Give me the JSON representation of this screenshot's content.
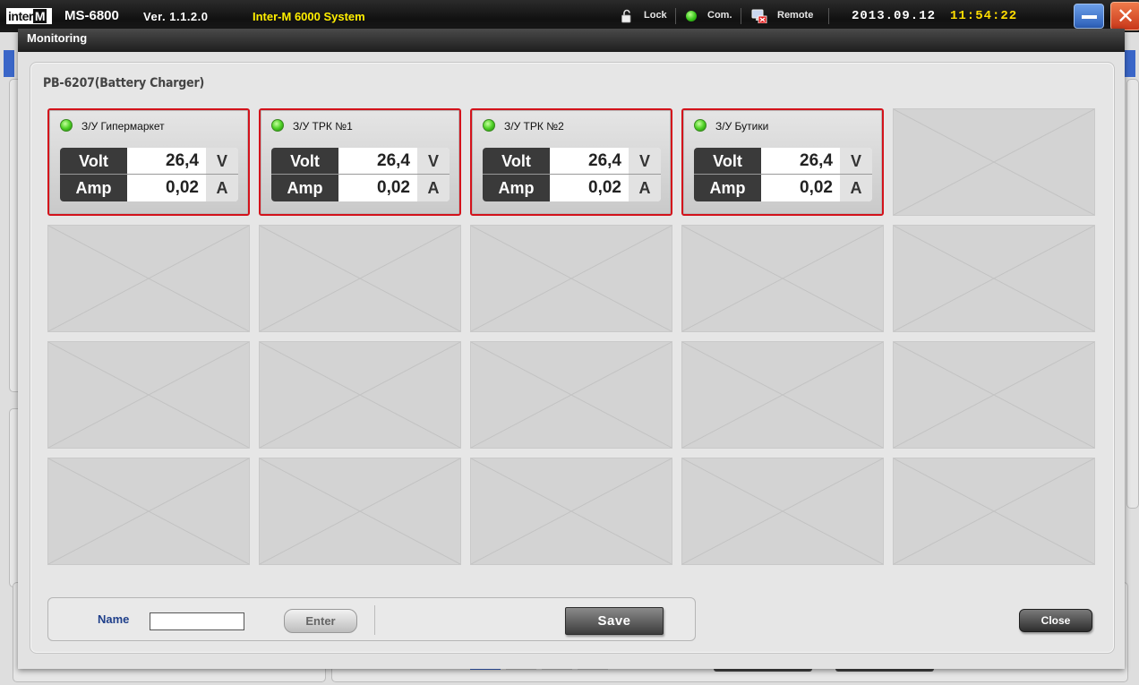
{
  "app": {
    "logo_prefix": "inter",
    "logo_suffix": "M",
    "model": "MS-6800",
    "version": "Ver. 1.1.2.0",
    "system": "Inter-M 6000 System",
    "lock_label": "Lock",
    "com_label": "Com.",
    "remote_label": "Remote",
    "date": "2013.09.12",
    "time": "11:54:22",
    "minimize_icon": "minimize-icon",
    "close_icon": "close-x-icon",
    "colors": {
      "system_text": "#ffee00",
      "time_text": "#ffdd00",
      "com_status": "#38c51a"
    }
  },
  "dialog": {
    "title": "Monitoring",
    "panel_title": "PB-6207(Battery Charger)",
    "active_border_color": "#d3121b",
    "units": [
      {
        "name": "З/У Гипермаркет",
        "status": "green",
        "volt_label": "Volt",
        "volt_value": "26,4",
        "volt_unit": "V",
        "amp_label": "Amp",
        "amp_value": "0,02",
        "amp_unit": "A"
      },
      {
        "name": "З/У ТРК №1",
        "status": "green",
        "volt_label": "Volt",
        "volt_value": "26,4",
        "volt_unit": "V",
        "amp_label": "Amp",
        "amp_value": "0,02",
        "amp_unit": "A"
      },
      {
        "name": "З/У ТРК №2",
        "status": "green",
        "volt_label": "Volt",
        "volt_value": "26,4",
        "volt_unit": "V",
        "amp_label": "Amp",
        "amp_value": "0,02",
        "amp_unit": "A"
      },
      {
        "name": "З/У Бутики",
        "status": "green",
        "volt_label": "Volt",
        "volt_value": "26,4",
        "volt_unit": "V",
        "amp_label": "Amp",
        "amp_value": "0,02",
        "amp_unit": "A"
      }
    ],
    "grid": {
      "columns": 5,
      "rows": 4
    },
    "bottom": {
      "name_label": "Name",
      "name_value": "",
      "enter_label": "Enter",
      "save_label": "Save"
    },
    "close_label": "Close"
  }
}
